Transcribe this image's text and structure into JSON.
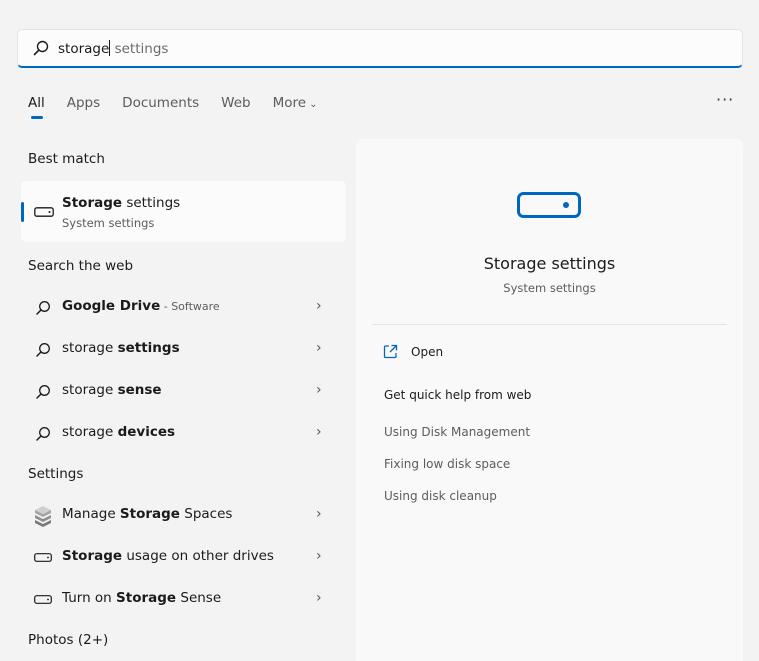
{
  "search": {
    "typed": "storage",
    "suggestion": " settings"
  },
  "tabs": [
    {
      "label": "All"
    },
    {
      "label": "Apps"
    },
    {
      "label": "Documents"
    },
    {
      "label": "Web"
    },
    {
      "label": "More"
    }
  ],
  "sections": {
    "best_match": "Best match",
    "search_web": "Search the web",
    "settings": "Settings",
    "photos": "Photos (2+)"
  },
  "best_match": {
    "title_bold": "Storage",
    "title_rest": " settings",
    "subtitle": "System settings"
  },
  "web_results": [
    {
      "bold": "Google Drive",
      "sub": " - Software"
    },
    {
      "pre": "storage ",
      "bold": "settings"
    },
    {
      "pre": "storage ",
      "bold": "sense"
    },
    {
      "pre": "storage ",
      "bold": "devices"
    }
  ],
  "settings_results": [
    {
      "pre": "Manage ",
      "bold": "Storage",
      "post": " Spaces"
    },
    {
      "bold": "Storage",
      "post": " usage on other drives"
    },
    {
      "pre": "Turn on ",
      "bold": "Storage",
      "post": " Sense"
    }
  ],
  "panel": {
    "title": "Storage settings",
    "subtitle": "System settings",
    "open_label": "Open",
    "quick_help": "Get quick help from web",
    "links": [
      "Using Disk Management",
      "Fixing low disk space",
      "Using disk cleanup"
    ]
  },
  "colors": {
    "accent": "#0067c0",
    "background": "#f3f3f3"
  }
}
